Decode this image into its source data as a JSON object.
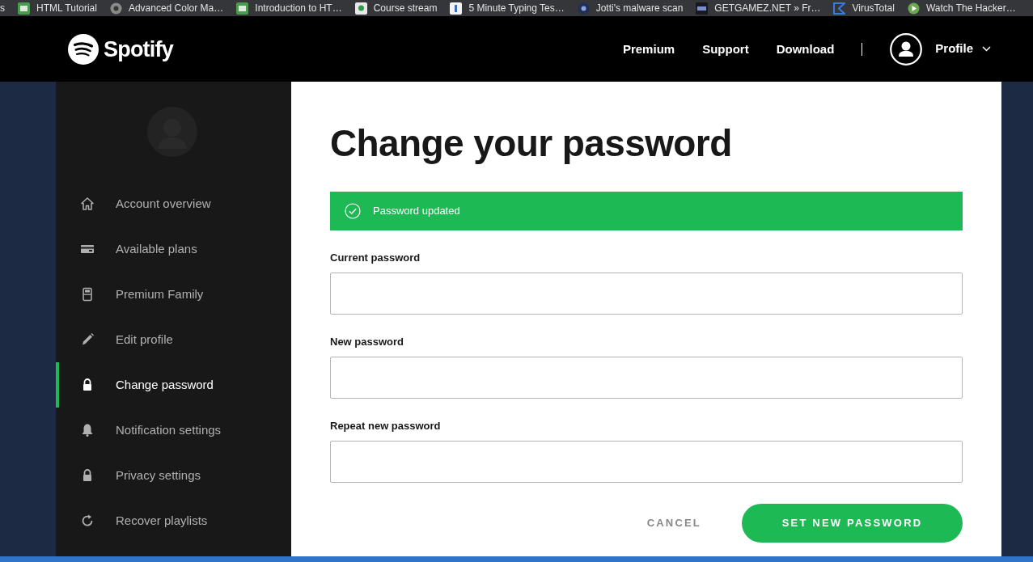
{
  "bookmarks_bar": {
    "cut_off_text": "s",
    "items": [
      {
        "label": "HTML Tutorial"
      },
      {
        "label": "Advanced Color Ma…"
      },
      {
        "label": "Introduction to HT…"
      },
      {
        "label": "Course stream"
      },
      {
        "label": "5 Minute Typing Tes…"
      },
      {
        "label": "Jotti's malware scan"
      },
      {
        "label": "GETGAMEZ.NET » Fr…"
      },
      {
        "label": "VirusTotal"
      },
      {
        "label": "Watch The Hacker…"
      }
    ]
  },
  "header": {
    "logo_text": "Spotify",
    "nav": [
      "Premium",
      "Support",
      "Download"
    ],
    "profile": {
      "label": "Profile"
    }
  },
  "sidebar": {
    "items": [
      {
        "label": "Account overview",
        "selected": false
      },
      {
        "label": "Available plans",
        "selected": false
      },
      {
        "label": "Premium Family",
        "selected": false
      },
      {
        "label": "Edit profile",
        "selected": false
      },
      {
        "label": "Change password",
        "selected": true
      },
      {
        "label": "Notification settings",
        "selected": false
      },
      {
        "label": "Privacy settings",
        "selected": false
      },
      {
        "label": "Recover playlists",
        "selected": false
      }
    ]
  },
  "main": {
    "title": "Change your password",
    "alert": {
      "kind": "success",
      "text": "Password updated"
    },
    "fields": [
      {
        "label": "Current password"
      },
      {
        "label": "New password"
      },
      {
        "label": "Repeat new password"
      }
    ],
    "buttons": [
      {
        "kind": "secondary",
        "label": "CANCEL"
      },
      {
        "kind": "primary",
        "label": "SET NEW PASSWORD"
      }
    ]
  }
}
